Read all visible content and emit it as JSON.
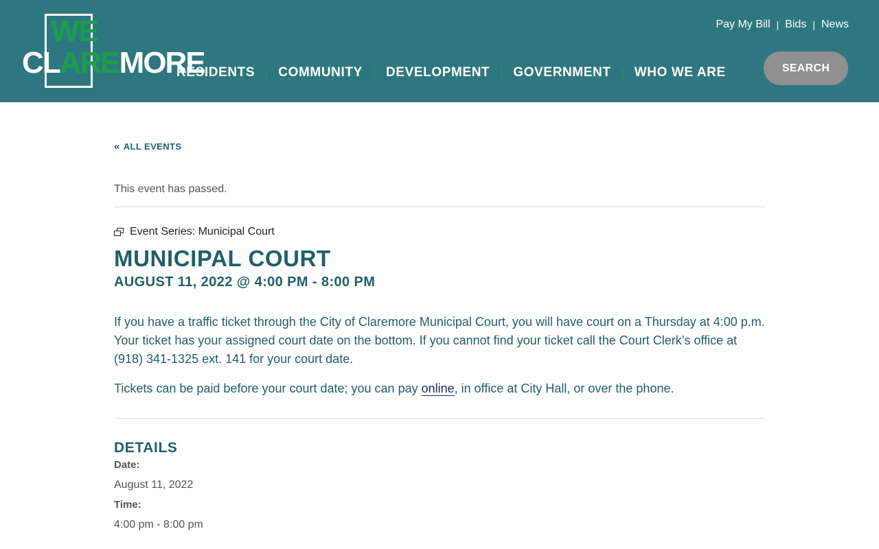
{
  "brand": {
    "logo_top": "WE",
    "logo_part1": "CL",
    "logo_part2": "ARE",
    "logo_part3": "MORE",
    "colors": {
      "header_bg": "#2e7781",
      "accent_green": "#1a9e4b",
      "text_teal": "#1f5f6b"
    }
  },
  "utility_nav": [
    {
      "label": "Pay My Bill"
    },
    {
      "label": "Bids"
    },
    {
      "label": "News"
    }
  ],
  "utility_separator": "|",
  "main_nav": [
    {
      "label": "RESIDENTS"
    },
    {
      "label": "COMMUNITY"
    },
    {
      "label": "DEVELOPMENT"
    },
    {
      "label": "GOVERNMENT"
    },
    {
      "label": "WHO WE ARE"
    }
  ],
  "nav_separator": "|",
  "search": {
    "label": "SEARCH"
  },
  "event": {
    "back_icon": "double-chevron-left-icon",
    "back_label": "ALL EVENTS",
    "notice": "This event has passed.",
    "series_icon": "event-series-icon",
    "series_label": "Event Series: Municipal Court",
    "title": "MUNICIPAL COURT",
    "datetime": "AUGUST 11, 2022 @ 4:00 PM - 8:00 PM",
    "description_1": "If you have a traffic ticket through the City of Claremore Municipal Court, you will have court on a Thursday at 4:00 p.m. Your ticket has your assigned court date on the bottom. If you cannot find your ticket call the Court Clerk’s office at (918) 341-1325 ext. 141 for your court date.",
    "description_2_before": "Tickets can be paid before your court date; you can pay ",
    "description_2_link": "online",
    "description_2_after": ", in office at City Hall, or over the phone."
  },
  "details": {
    "heading": "DETAILS",
    "date_label": "Date:",
    "date_value": "August 11, 2022",
    "time_label": "Time:",
    "time_value": "4:00 pm - 8:00 pm"
  }
}
